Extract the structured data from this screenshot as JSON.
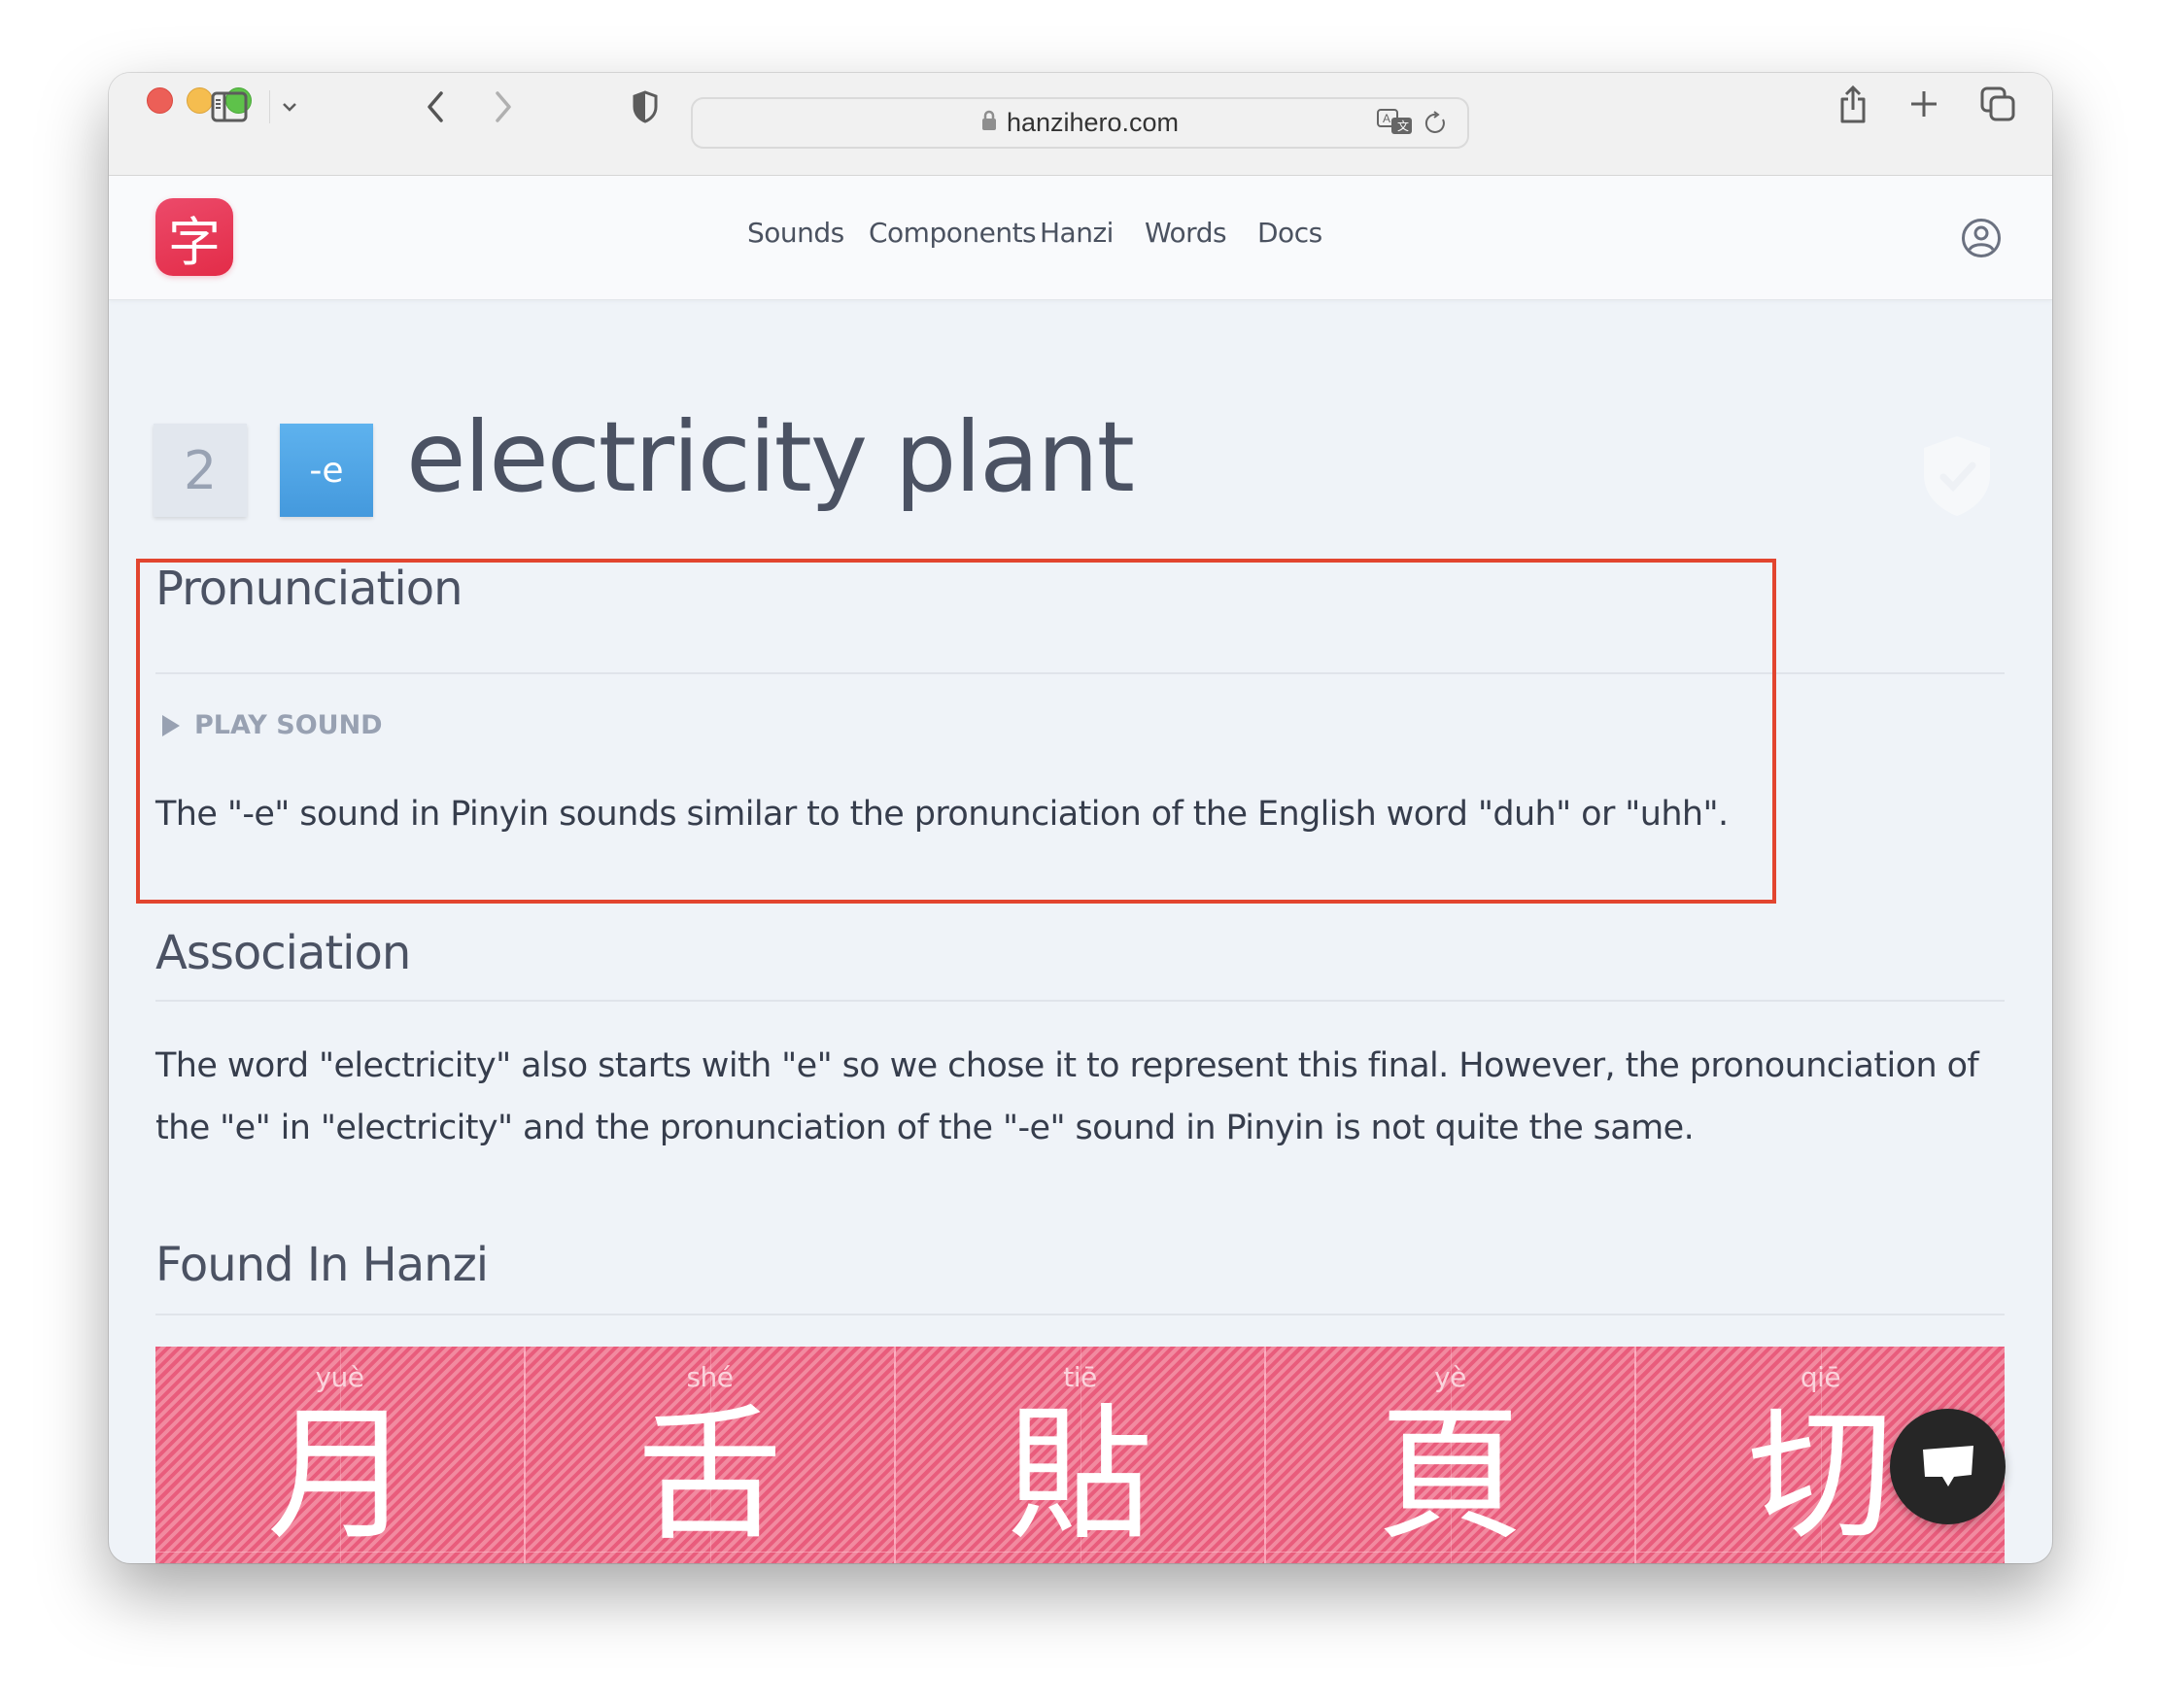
{
  "browser": {
    "url": "hanzihero.com",
    "icons": {
      "close": "close-window-icon",
      "minimize": "minimize-window-icon",
      "zoom": "zoom-window-icon",
      "sidebar": "sidebar-icon",
      "sidebar_menu": "chevron-down-icon",
      "back": "back-arrow-icon",
      "forward": "forward-arrow-icon",
      "privacy": "shield-icon",
      "lock": "lock-icon",
      "translate": "translate-icon",
      "reload": "reload-icon",
      "share": "share-icon",
      "new_tab": "plus-icon",
      "tabs": "tab-overview-icon"
    },
    "colors": {
      "close": "#ec5f57",
      "minimize": "#f5bd4f",
      "zoom": "#5ec24a"
    }
  },
  "site": {
    "logo_char": "字",
    "logo_color": "#e8344f",
    "nav": [
      {
        "label": "Sounds"
      },
      {
        "label": "Components"
      },
      {
        "label": "Hanzi"
      },
      {
        "label": "Words"
      },
      {
        "label": "Docs"
      }
    ],
    "user_icon": "user-account-icon"
  },
  "page": {
    "tone_number": "2",
    "final_badge": "-e",
    "final_badge_color": "#4a9fe0",
    "title": "electricity plant",
    "status_icon": "shield-check-icon"
  },
  "pronunciation": {
    "heading": "Pronunciation",
    "play_label": "PLAY SOUND",
    "text": "The \"-e\" sound in Pinyin sounds similar to the pronunciation of the English word \"duh\" or \"uhh\"."
  },
  "association": {
    "heading": "Association",
    "line1": "The word \"electricity\" also starts with \"e\" so we chose it to represent this final. However, the pronounciation of",
    "line2": "the \"e\" in \"electricity\" and the pronunciation of the \"-e\" sound in Pinyin is not quite the same."
  },
  "found_in_hanzi": {
    "heading": "Found In Hanzi",
    "tile_color": "#ea5e7e",
    "items": [
      {
        "pinyin": "yuè",
        "char": "月"
      },
      {
        "pinyin": "shé",
        "char": "舌"
      },
      {
        "pinyin": "tiē",
        "char": "貼"
      },
      {
        "pinyin": "yè",
        "char": "頁"
      },
      {
        "pinyin": "qiē",
        "char": "切"
      }
    ]
  },
  "chat": {
    "icon": "chat-bubble-icon"
  },
  "annotation": {
    "highlight_color": "#e2452f"
  }
}
